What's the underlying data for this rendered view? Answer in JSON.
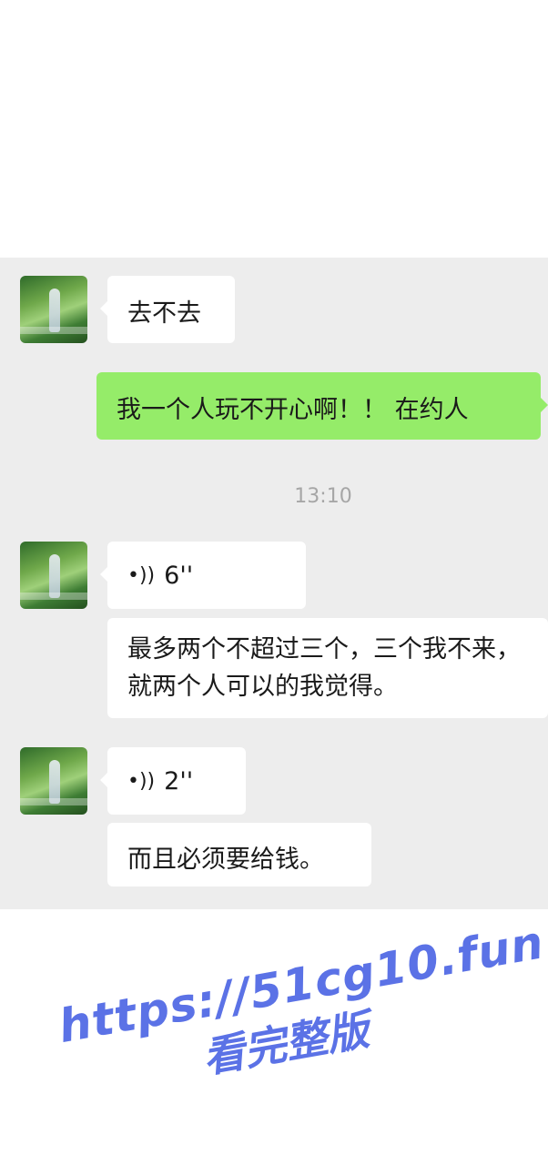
{
  "messages": {
    "m1": "去不去",
    "m2": "我一个人玩不开心啊！！ 在约人",
    "time": "13:10",
    "voice1": "6''",
    "m3": "最多两个不超过三个，三个我不来，就两个人可以的我觉得。",
    "voice2": "2''",
    "m4": "而且必须要给钱。"
  },
  "watermark": {
    "url": "https://51cg10.fun",
    "text": "看完整版"
  },
  "colors": {
    "chat_background": "#ededed",
    "sent_bubble": "#95ec69",
    "received_bubble": "#ffffff",
    "watermark": "#5b72e6"
  }
}
